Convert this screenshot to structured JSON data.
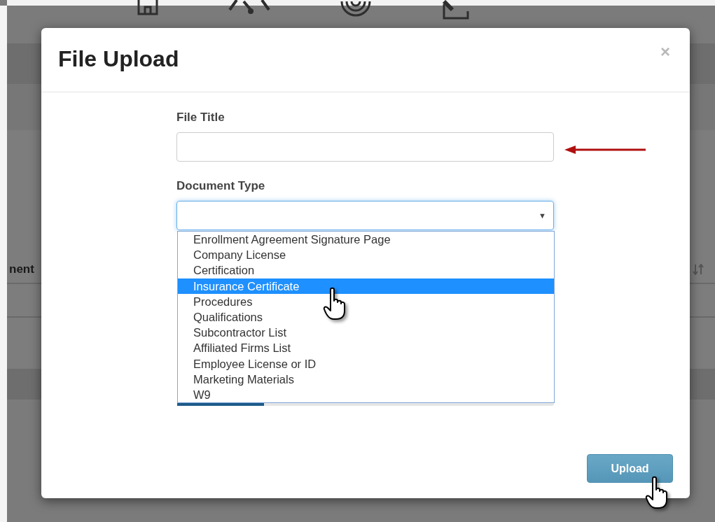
{
  "background_page": {
    "table_header": {
      "column_1": "nent"
    }
  },
  "dialog": {
    "title": "File Upload",
    "close": "×",
    "file_title": {
      "label": "File Title"
    },
    "document_type": {
      "label": "Document Type",
      "caret": "▼",
      "options": [
        {
          "label": "Enrollment Agreement Signature Page",
          "selected": false
        },
        {
          "label": "Company License",
          "selected": false
        },
        {
          "label": "Certification",
          "selected": false
        },
        {
          "label": "Insurance Certificate",
          "selected": true
        },
        {
          "label": "Procedures",
          "selected": false
        },
        {
          "label": "Qualifications",
          "selected": false
        },
        {
          "label": "Subcontractor List",
          "selected": false
        },
        {
          "label": "Affiliated Firms List",
          "selected": false
        },
        {
          "label": "Employee License or ID",
          "selected": false
        },
        {
          "label": "Marketing Materials",
          "selected": false
        },
        {
          "label": "W9",
          "selected": false
        }
      ]
    },
    "progress": {
      "level": 0.23
    },
    "upload_button": "Upload"
  }
}
